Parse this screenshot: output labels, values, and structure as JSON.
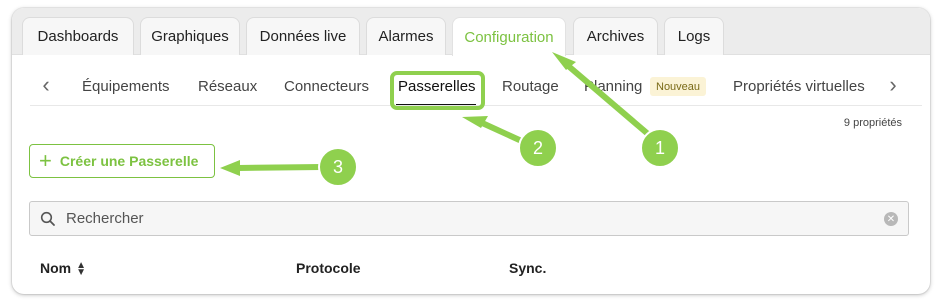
{
  "tabs": [
    {
      "label": "Dashboards"
    },
    {
      "label": "Graphiques"
    },
    {
      "label": "Données live"
    },
    {
      "label": "Alarmes"
    },
    {
      "label": "Configuration",
      "active": true
    },
    {
      "label": "Archives"
    },
    {
      "label": "Logs"
    }
  ],
  "subnav": {
    "items": [
      {
        "label": "Équipements"
      },
      {
        "label": "Réseaux"
      },
      {
        "label": "Connecteurs"
      },
      {
        "label": "Passerelles",
        "active": true
      },
      {
        "label": "Routage"
      },
      {
        "label": "Planning",
        "badge": "Nouveau"
      },
      {
        "label": "Propriétés virtuelles"
      }
    ],
    "prev_icon": "chevron-left-icon",
    "next_icon": "chevron-right-icon"
  },
  "properties_count": "9 propriétés",
  "create_button": {
    "label": "Créer une Passerelle",
    "icon": "plus-icon"
  },
  "search": {
    "placeholder": "Rechercher",
    "icon": "search-icon",
    "clear_icon": "clear-icon"
  },
  "table": {
    "columns": [
      {
        "label": "Nom",
        "sortable": true
      },
      {
        "label": "Protocole"
      },
      {
        "label": "Sync."
      }
    ]
  },
  "annotations": [
    "1",
    "2",
    "3"
  ],
  "colors": {
    "accent": "#7cc241",
    "annotation": "#8fd04e",
    "badge_bg": "#fbf3d6"
  }
}
